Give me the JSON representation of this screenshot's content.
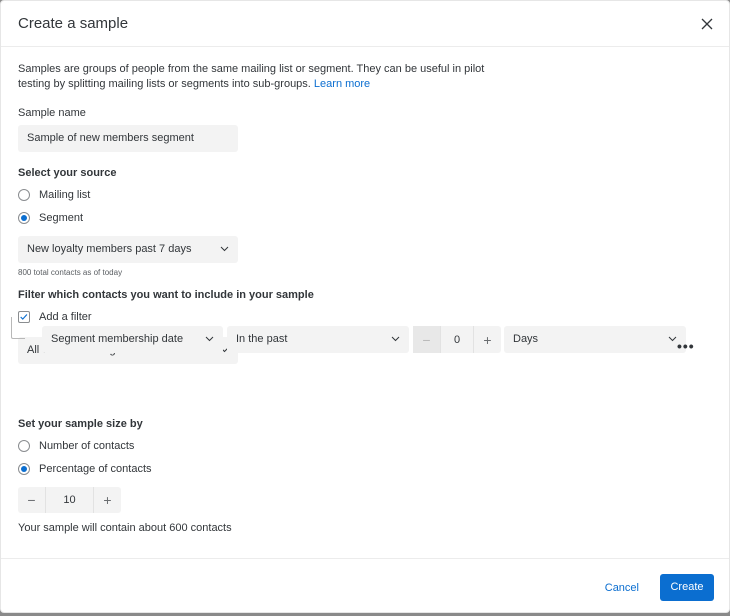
{
  "header": {
    "title": "Create a sample",
    "close_icon": "close-icon"
  },
  "description": {
    "text": "Samples are groups of people from the same mailing list or segment. They can be useful in pilot testing by splitting mailing lists or segments into sub-groups.",
    "link": "Learn more"
  },
  "sample_name": {
    "label": "Sample name",
    "value": "Sample of new members segment"
  },
  "source": {
    "heading": "Select your source",
    "options": [
      {
        "label": "Mailing list",
        "selected": false
      },
      {
        "label": "Segment",
        "selected": true
      }
    ],
    "selected_segment": "New loyalty members past 7 days",
    "contacts_note": "800 total contacts as of today"
  },
  "filter": {
    "heading": "Filter which contacts you want to include in your sample",
    "add_filter_label": "Add a filter",
    "add_filter_checked": true,
    "logic": "All of the following are true",
    "condition": {
      "field": "Segment membership date",
      "operator": "In the past",
      "amount": "0",
      "unit": "Days"
    },
    "more_icon": "more-horizontal-icon"
  },
  "sample_size": {
    "heading": "Set your sample size by",
    "options": [
      {
        "label": "Number of contacts",
        "selected": false
      },
      {
        "label": "Percentage of contacts",
        "selected": true
      }
    ],
    "value": "10",
    "summary": "Your sample will contain about 600 contacts"
  },
  "footer": {
    "cancel": "Cancel",
    "create": "Create"
  },
  "colors": {
    "accent": "#0b6ed0",
    "field_bg": "#f3f3f3"
  }
}
